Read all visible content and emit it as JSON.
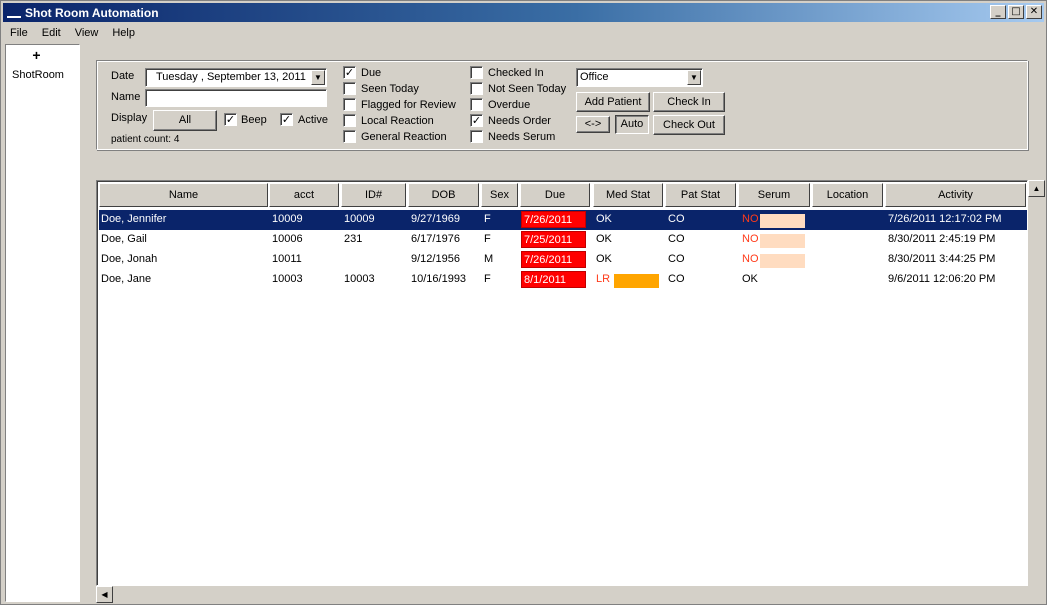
{
  "window": {
    "title": "Shot Room Automation",
    "controls": {
      "minimize": "_",
      "maximize": "□",
      "close": "✕"
    }
  },
  "menu": [
    "File",
    "Edit",
    "View",
    "Help"
  ],
  "tree": {
    "toggle": "+",
    "label": "ShotRoom"
  },
  "filters": {
    "date_label": "Date",
    "date_value": "Tuesday   , September 13, 2011",
    "name_label": "Name",
    "name_value": "",
    "display_label": "Display",
    "display_button": "All",
    "beep_label": "Beep",
    "active_label": "Active",
    "patient_count": "patient count:  4",
    "col1": [
      {
        "label": "Due",
        "checked": true
      },
      {
        "label": "Seen Today",
        "checked": false
      },
      {
        "label": "Flagged for Review",
        "checked": false
      },
      {
        "label": "Local Reaction",
        "checked": false
      },
      {
        "label": "General Reaction",
        "checked": false
      }
    ],
    "col2": [
      {
        "label": "Checked In",
        "checked": false
      },
      {
        "label": "Not Seen Today",
        "checked": false
      },
      {
        "label": "Overdue",
        "checked": false
      },
      {
        "label": "Needs Order",
        "checked": true
      },
      {
        "label": "Needs Serum",
        "checked": false
      }
    ],
    "location_value": "Office",
    "add_patient": "Add Patient",
    "check_in": "Check In",
    "swap": "<->",
    "auto": "Auto",
    "check_out": "Check Out"
  },
  "grid": {
    "columns": [
      "Name",
      "acct",
      "ID#",
      "DOB",
      "Sex",
      "Due",
      "Med Stat",
      "Pat Stat",
      "Serum",
      "Location",
      "Activity"
    ],
    "rows": [
      {
        "name": "Doe, Jennifer",
        "acct": "10009",
        "id": "10009",
        "dob": "9/27/1969",
        "sex": "F",
        "due": "7/26/2011",
        "med": "OK",
        "pat": "CO",
        "serum": "NO",
        "location": "",
        "activity": "7/26/2011 12:17:02 PM"
      },
      {
        "name": "Doe, Gail",
        "acct": "10006",
        "id": "231",
        "dob": "6/17/1976",
        "sex": "F",
        "due": "7/25/2011",
        "med": "OK",
        "pat": "CO",
        "serum": "NO",
        "location": "",
        "activity": "8/30/2011 2:45:19 PM"
      },
      {
        "name": "Doe, Jonah",
        "acct": "10011",
        "id": "",
        "dob": "9/12/1956",
        "sex": "M",
        "due": "7/26/2011",
        "med": "OK",
        "pat": "CO",
        "serum": "NO",
        "location": "",
        "activity": "8/30/2011 3:44:25 PM"
      },
      {
        "name": "Doe, Jane",
        "acct": "10003",
        "id": "10003",
        "dob": "10/16/1993",
        "sex": "F",
        "due": "8/1/2011",
        "med": "LR",
        "pat": "CO",
        "serum": "OK",
        "location": "",
        "activity": "9/6/2011 12:06:20 PM"
      }
    ]
  },
  "colors": {
    "selection": "#0a246a",
    "due_overdue": "#ff0000",
    "serum_no_swatch": "#ffdcc0",
    "med_lr_swatch": "#ffa500"
  }
}
